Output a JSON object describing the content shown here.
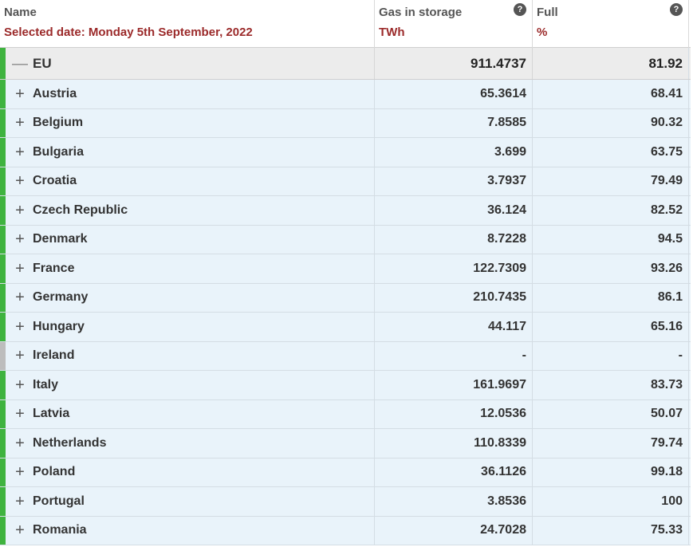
{
  "header": {
    "name": {
      "title": "Name",
      "subtitle": "Selected date: Monday 5th September, 2022"
    },
    "gas": {
      "title": "Gas in storage",
      "unit": "TWh",
      "help_icon": "question-circle-icon",
      "help_glyph": "?"
    },
    "full": {
      "title": "Full",
      "unit": "%",
      "help_icon": "question-circle-icon",
      "help_glyph": "?"
    }
  },
  "colors": {
    "bar_ok": "#3fb33f",
    "bar_nodata": "#bdbdbd",
    "subtitle": "#9b2a2a",
    "row_bg": "#e9f3fa",
    "total_bg": "#ececec"
  },
  "total": {
    "toggle": "—",
    "name": "EU",
    "gas": "911.4737",
    "full": "81.92"
  },
  "rows": [
    {
      "toggle": "+",
      "name": "Austria",
      "gas": "65.3614",
      "full": "68.41"
    },
    {
      "toggle": "+",
      "name": "Belgium",
      "gas": "7.8585",
      "full": "90.32"
    },
    {
      "toggle": "+",
      "name": "Bulgaria",
      "gas": "3.699",
      "full": "63.75"
    },
    {
      "toggle": "+",
      "name": "Croatia",
      "gas": "3.7937",
      "full": "79.49"
    },
    {
      "toggle": "+",
      "name": "Czech Republic",
      "gas": "36.124",
      "full": "82.52"
    },
    {
      "toggle": "+",
      "name": "Denmark",
      "gas": "8.7228",
      "full": "94.5"
    },
    {
      "toggle": "+",
      "name": "France",
      "gas": "122.7309",
      "full": "93.26"
    },
    {
      "toggle": "+",
      "name": "Germany",
      "gas": "210.7435",
      "full": "86.1"
    },
    {
      "toggle": "+",
      "name": "Hungary",
      "gas": "44.117",
      "full": "65.16"
    },
    {
      "toggle": "+",
      "name": "Ireland",
      "gas": "-",
      "full": "-"
    },
    {
      "toggle": "+",
      "name": "Italy",
      "gas": "161.9697",
      "full": "83.73"
    },
    {
      "toggle": "+",
      "name": "Latvia",
      "gas": "12.0536",
      "full": "50.07"
    },
    {
      "toggle": "+",
      "name": "Netherlands",
      "gas": "110.8339",
      "full": "79.74"
    },
    {
      "toggle": "+",
      "name": "Poland",
      "gas": "36.1126",
      "full": "99.18"
    },
    {
      "toggle": "+",
      "name": "Portugal",
      "gas": "3.8536",
      "full": "100"
    },
    {
      "toggle": "+",
      "name": "Romania",
      "gas": "24.7028",
      "full": "75.33"
    }
  ]
}
